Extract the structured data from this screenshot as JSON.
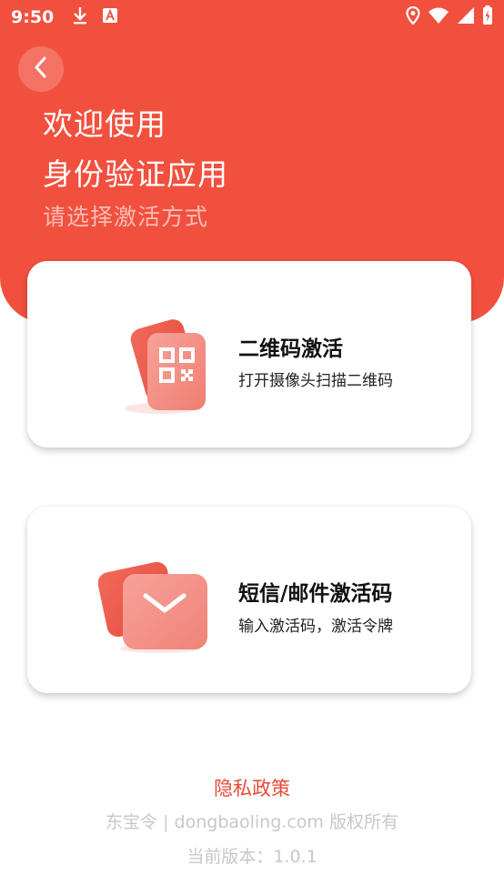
{
  "status_bar": {
    "time": "9:50",
    "icons": [
      "download-icon",
      "font-a-icon",
      "location-icon",
      "wifi-icon",
      "signal-icon",
      "battery-icon"
    ]
  },
  "header": {
    "back_icon": "chevron-left-icon",
    "title_line1": "欢迎使用",
    "title_line2": "身份验证应用",
    "subtitle": "请选择激活方式"
  },
  "options": [
    {
      "icon": "qr-code-icon",
      "title": "二维码激活",
      "description": "打开摄像头扫描二维码"
    },
    {
      "icon": "envelope-icon",
      "title": "短信/邮件激活码",
      "description": "输入激活码，激活令牌"
    }
  ],
  "footer": {
    "privacy_link": "隐私政策",
    "copyright": "东宝令 | dongbaoling.com  版权所有",
    "version": "当前版本：1.0.1"
  },
  "colors": {
    "accent": "#f2503e",
    "link": "#e84a37",
    "muted": "#c8c8c8"
  }
}
